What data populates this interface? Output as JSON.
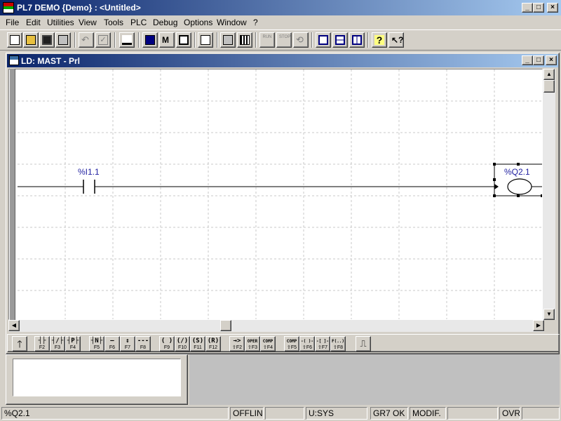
{
  "window": {
    "title": "PL7 DEMO {Demo} : <Untitled>",
    "minimize": "_",
    "maximize": "□",
    "close": "×"
  },
  "menu": [
    "File",
    "Edit",
    "Utilities",
    "View",
    "Tools",
    "PLC",
    "Debug",
    "Options",
    "Window",
    "?"
  ],
  "toolbar": {
    "icons": [
      "new-icon",
      "open-icon",
      "save-icon",
      "print-icon",
      "undo-icon",
      "validate-icon",
      "export-icon",
      "cpu-icon",
      "find-icon",
      "cards-icon",
      "transfer-icon",
      "connect-icon",
      "config-icon",
      "run-icon",
      "stop-icon",
      "init-icon",
      "cascade-icon",
      "tile-horizontal-icon",
      "tile-vertical-icon",
      "help-icon",
      "context-help-icon"
    ],
    "run_label": "RUN",
    "stop_label": "STOP"
  },
  "editor": {
    "title": "LD: MAST - Prl",
    "contact_label": "%I1.1",
    "coil_label": "%Q2.1"
  },
  "palette": {
    "items": [
      {
        "sym": "┤├",
        "fkey": "F2"
      },
      {
        "sym": "┤/├",
        "fkey": "F3"
      },
      {
        "sym": "┤P├",
        "fkey": "F4"
      },
      {
        "sym": "┤N├",
        "fkey": "F5"
      },
      {
        "sym": "—",
        "fkey": "F6"
      },
      {
        "sym": "↕",
        "fkey": "F7"
      },
      {
        "sym": "---",
        "fkey": "F8"
      },
      {
        "sym": "( )",
        "fkey": "F9"
      },
      {
        "sym": "(/)",
        "fkey": "F10"
      },
      {
        "sym": "(S)",
        "fkey": "F11"
      },
      {
        "sym": "(R)",
        "fkey": "F12"
      },
      {
        "sym": "→>",
        "fkey": "⇧F2"
      },
      {
        "sym": "OPER",
        "fkey": "⇧F3"
      },
      {
        "sym": "COMP",
        "fkey": "⇧F4"
      },
      {
        "sym": "COMP",
        "fkey": "⇧F5"
      },
      {
        "sym": "-( )-",
        "fkey": "⇧F6"
      },
      {
        "sym": "-[ ]-",
        "fkey": "⇧F7"
      },
      {
        "sym": "F(..)",
        "fkey": "⇧F8"
      }
    ]
  },
  "status": {
    "variable": "%Q2.1",
    "mode": "OFFLINE",
    "section": "U:SYS",
    "gr7": "GR7 OK",
    "modif": "MODIF.",
    "ovr": "OVR"
  }
}
